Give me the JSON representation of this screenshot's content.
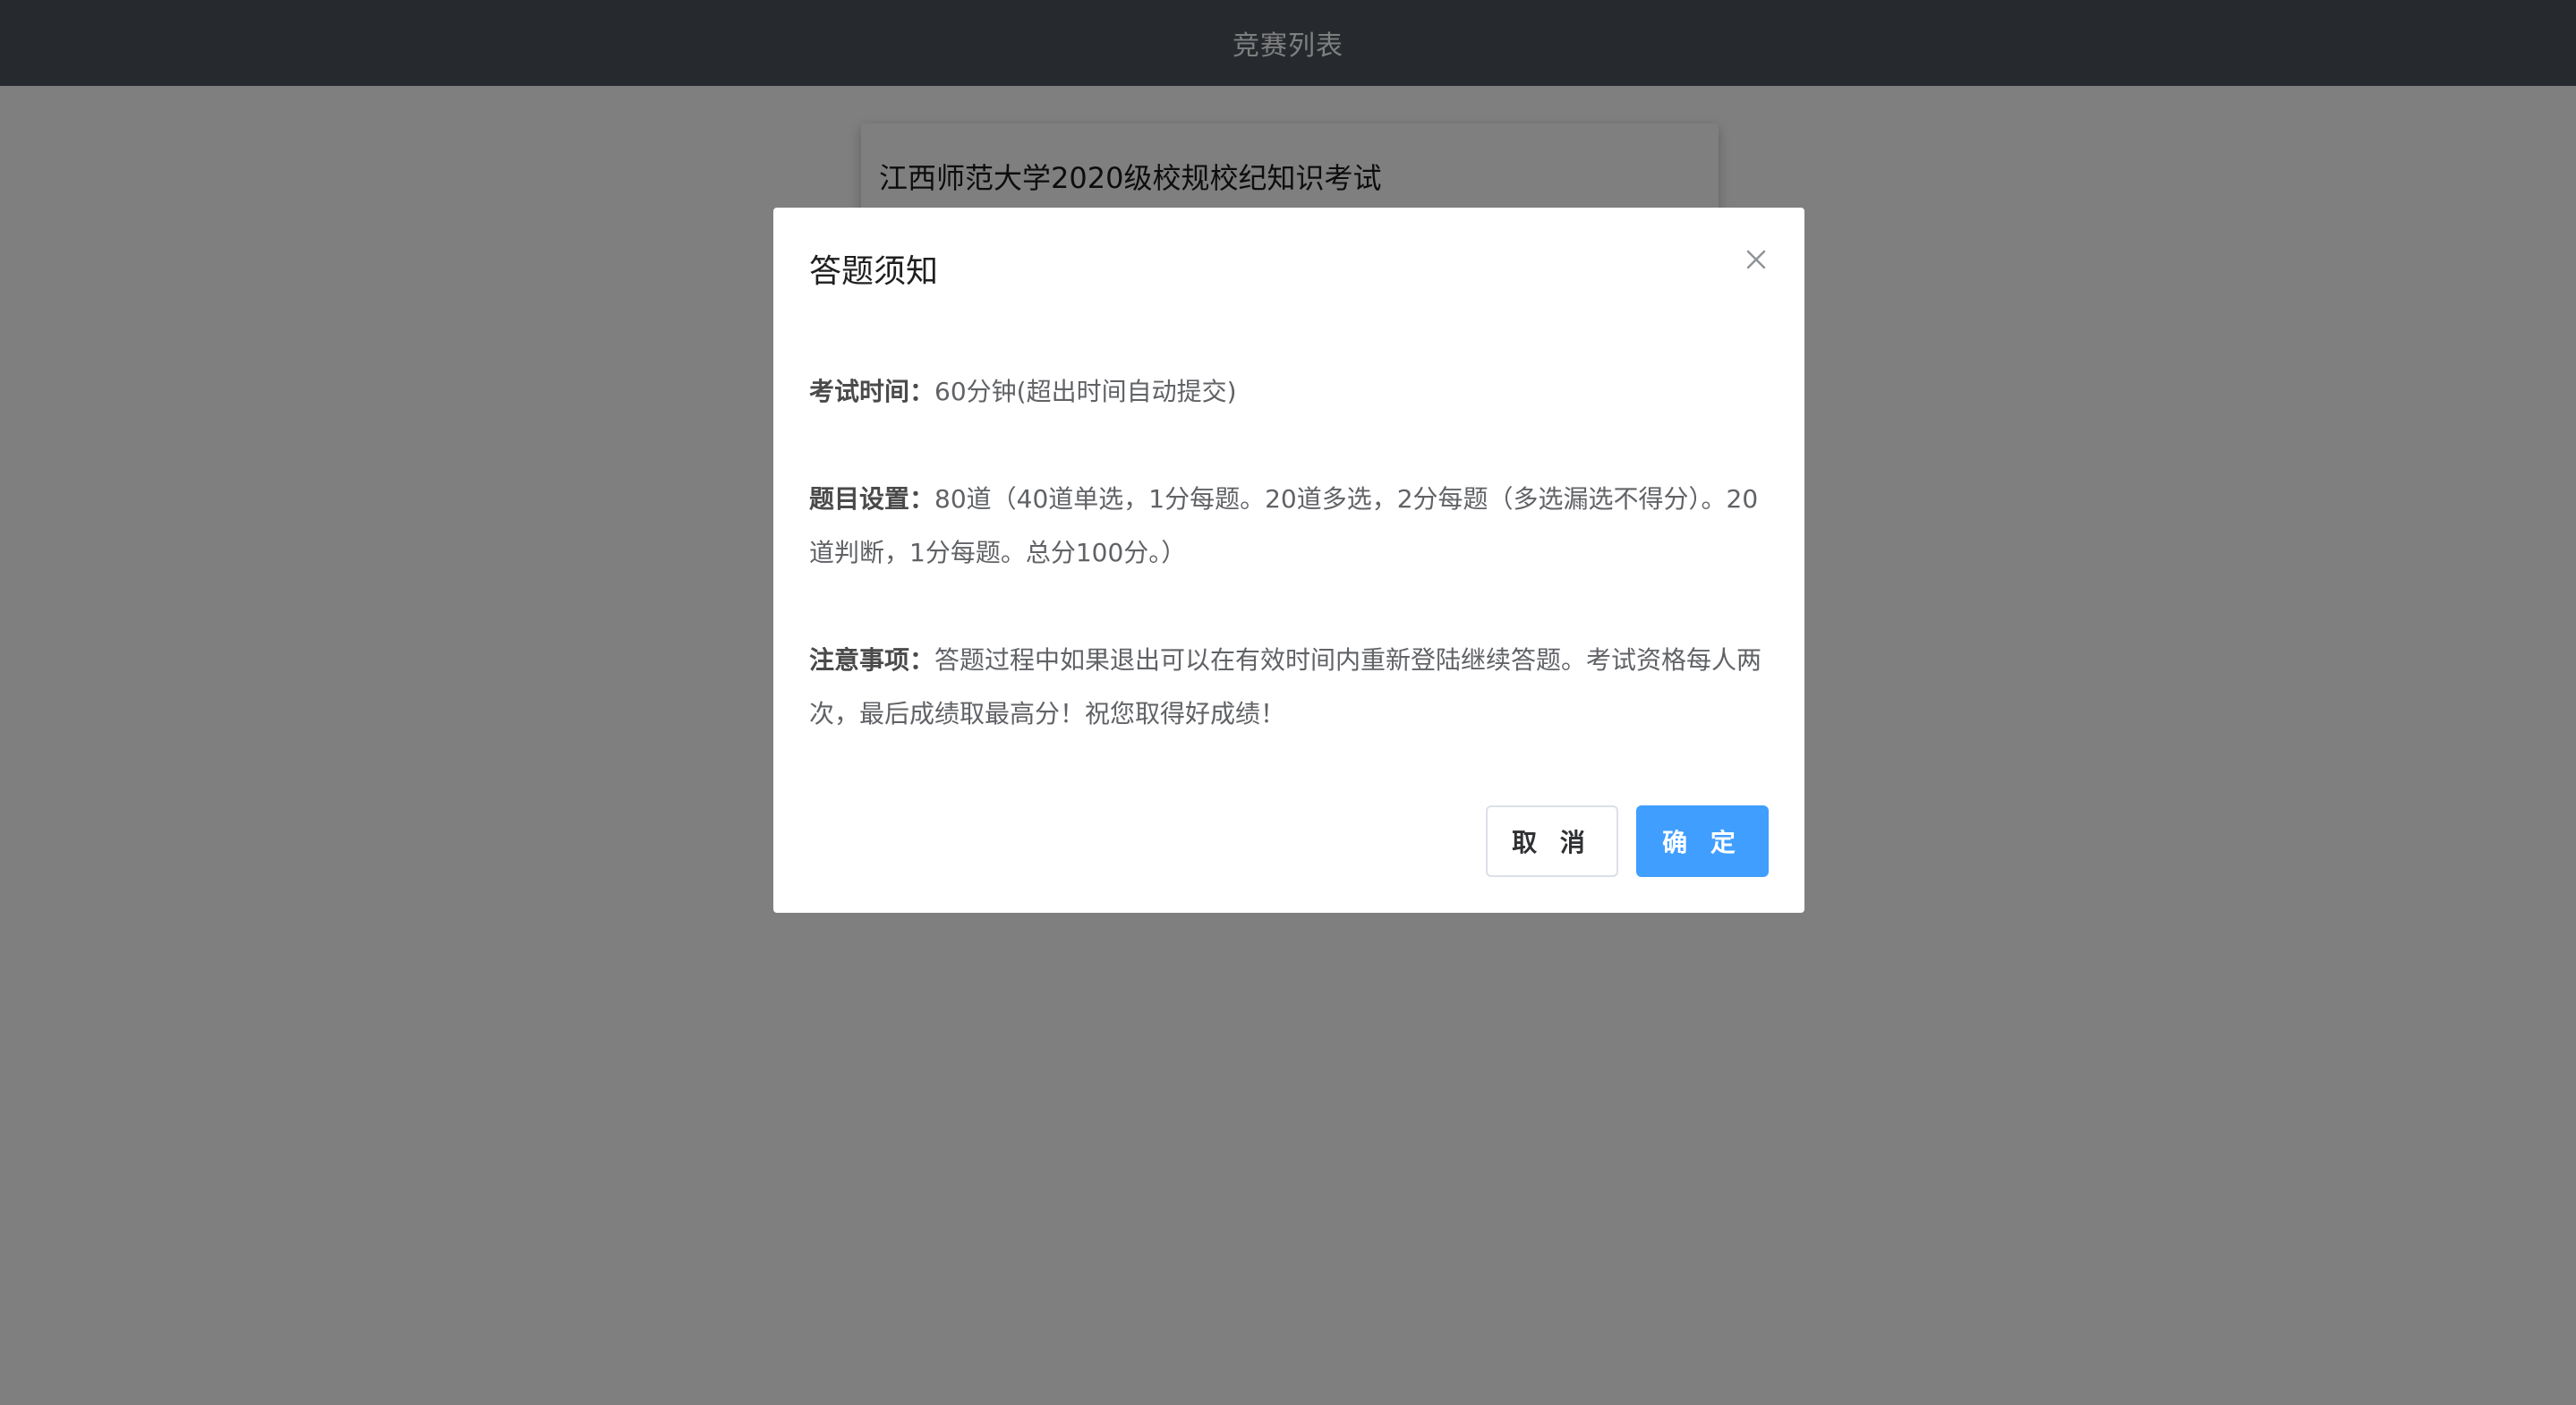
{
  "header": {
    "title": "竞赛列表"
  },
  "contest_list": {
    "items": [
      {
        "title": "江西师范大学2020级校规校纪知识考试"
      }
    ]
  },
  "dialog": {
    "title": "答题须知",
    "close_icon": "close-icon",
    "sections": [
      {
        "label": "考试时间：",
        "text": "60分钟(超出时间自动提交)"
      },
      {
        "label": "题目设置：",
        "text": "80道（40道单选，1分每题。20道多选，2分每题（多选漏选不得分）。20道判断，1分每题。总分100分。）"
      },
      {
        "label": "注意事项：",
        "text": "答题过程中如果退出可以在有效时间内重新登陆继续答题。考试资格每人两次，最后成绩取最高分！祝您取得好成绩！"
      }
    ],
    "cancel_label": "取 消",
    "confirm_label": "确 定"
  },
  "colors": {
    "header_bg": "#4d545e",
    "primary": "#409eff",
    "overlay": "rgba(0,0,0,0.5)"
  }
}
